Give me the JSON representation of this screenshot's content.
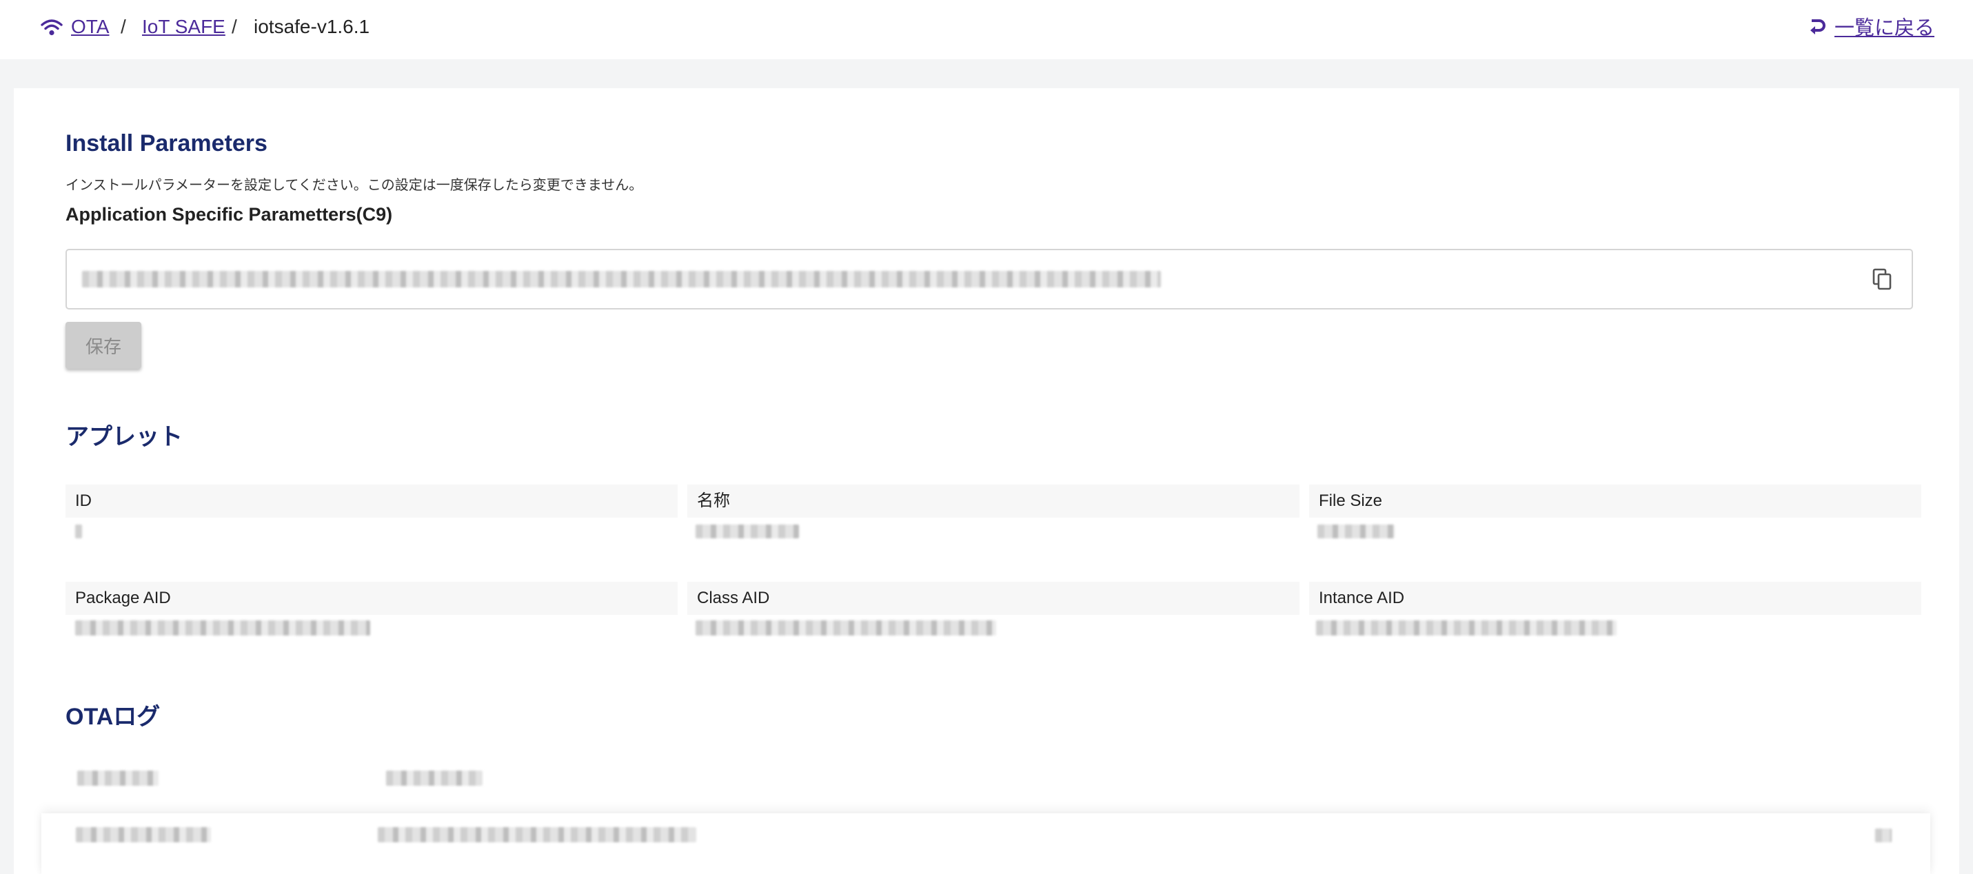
{
  "breadcrumb": {
    "icon": "wifi-icon",
    "items": [
      {
        "label": "OTA",
        "link": true
      },
      {
        "label": "IoT SAFE",
        "link": true
      },
      {
        "label": "iotsafe-v1.6.1",
        "link": false
      }
    ],
    "separator": "/"
  },
  "back_link": {
    "label": "一覧に戻る",
    "icon": "return-arrow-icon"
  },
  "install": {
    "title": "Install Parameters",
    "description": "インストールパラメーターを設定してください。この設定は一度保存したら変更できません。",
    "field_label": "Application Specific Parametters(C9)",
    "copy_icon": "copy-icon",
    "save_label": "保存"
  },
  "applet": {
    "title": "アプレット",
    "fields": [
      {
        "label": "ID"
      },
      {
        "label": "名称"
      },
      {
        "label": "File Size"
      },
      {
        "label": "Package AID"
      },
      {
        "label": "Class AID"
      },
      {
        "label": "Intance AID"
      }
    ]
  },
  "ota_log": {
    "title": "OTAログ"
  },
  "colors": {
    "heading": "#1a2a6c",
    "link": "#4b2a9a",
    "page_bg": "#f3f4f5",
    "button_disabled": "#cdcdcd"
  }
}
